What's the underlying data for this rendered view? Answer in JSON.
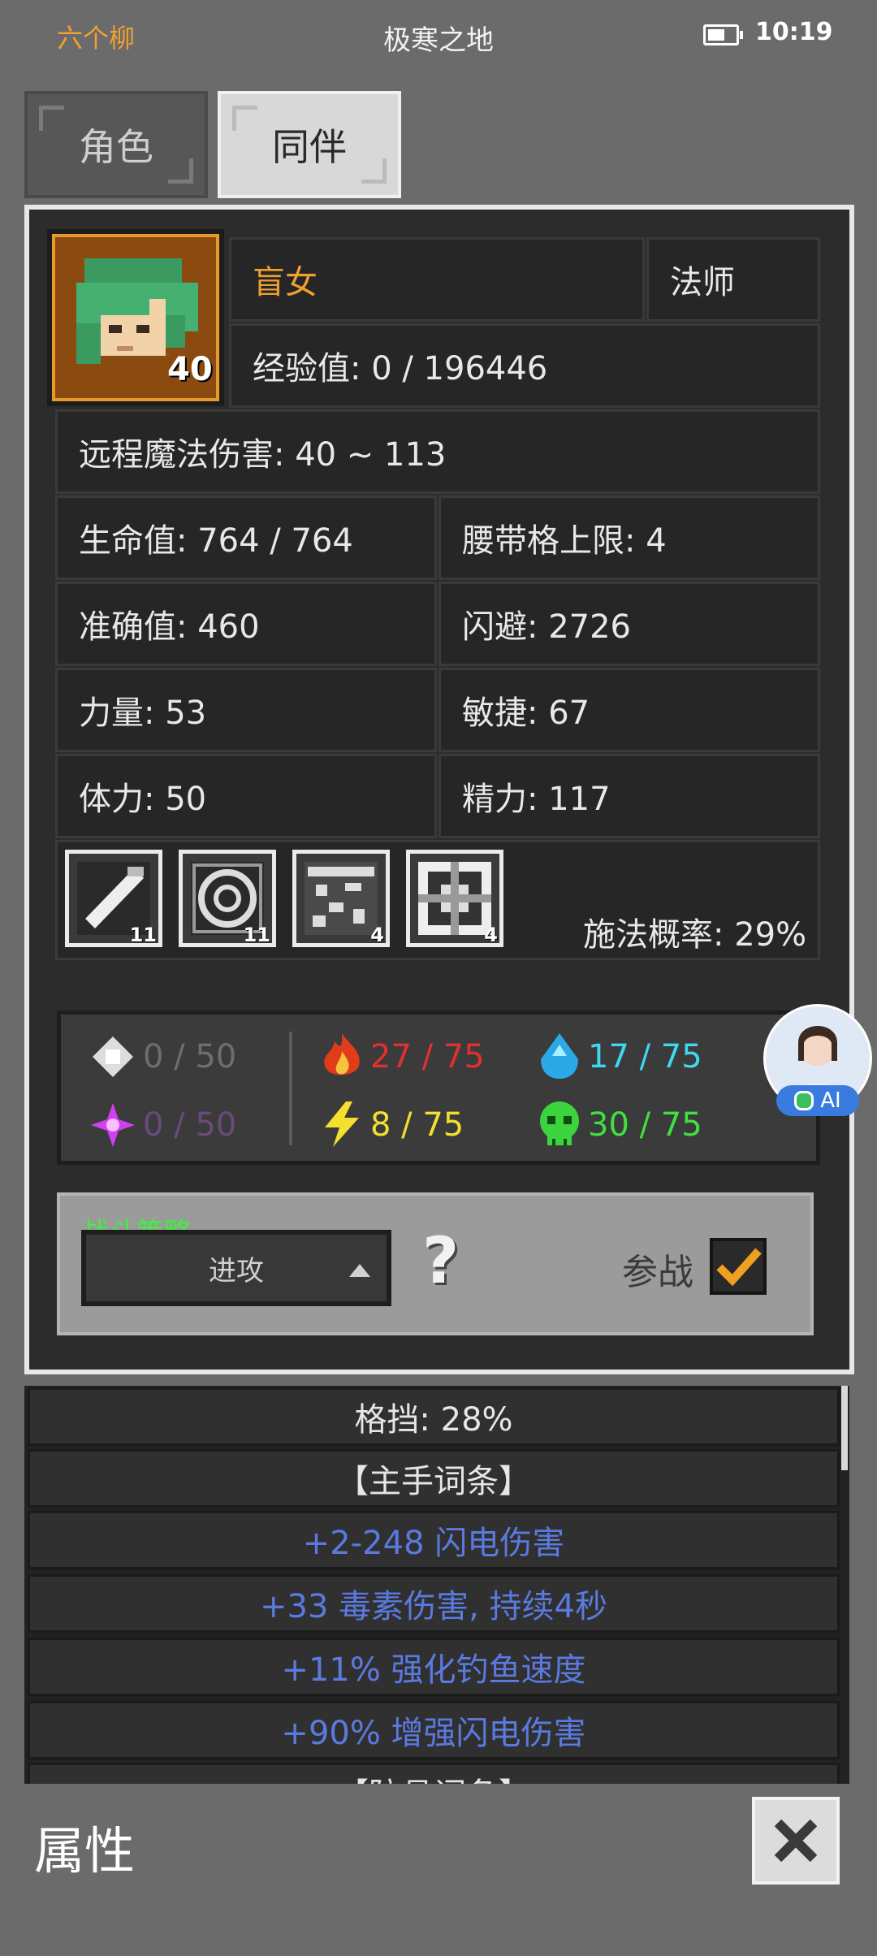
{
  "status_bar": {
    "player_name": "六个柳",
    "location": "极寒之地",
    "time": "10:19"
  },
  "tabs": [
    {
      "label": "角色"
    },
    {
      "label": "同伴"
    }
  ],
  "companion": {
    "name": "盲女",
    "class": "法师",
    "level": "40",
    "exp": "经验值: 0 / 196446",
    "damage": "远程魔法伤害: 40 ~ 113",
    "stats": [
      "生命值: 764 / 764",
      "腰带格上限: 4",
      "准确值: 460",
      "闪避: 2726",
      "力量: 53",
      "敏捷: 67",
      "体力: 50",
      "精力: 117"
    ],
    "skills": [
      {
        "icon": "wand-skill-icon",
        "count": "11"
      },
      {
        "icon": "rune-circle-skill-icon",
        "count": "11"
      },
      {
        "icon": "cracked-stone-skill-icon",
        "count": "4"
      },
      {
        "icon": "frost-block-skill-icon",
        "count": "4"
      }
    ],
    "cast_chance": "施法概率: 29%"
  },
  "resistances": [
    {
      "icon": "physical-icon",
      "value": "0 / 50",
      "color": "#6e6e6e"
    },
    {
      "icon": "arcane-icon",
      "value": "0 / 50",
      "color": "#6a4a7a"
    },
    {
      "icon": "fire-icon",
      "value": "27 / 75",
      "color": "#e03030"
    },
    {
      "icon": "lightning-icon",
      "value": "8 / 75",
      "color": "#f0e030"
    },
    {
      "icon": "cold-icon",
      "value": "17 / 75",
      "color": "#40d8f0"
    },
    {
      "icon": "poison-icon",
      "value": "30 / 75",
      "color": "#40e040"
    }
  ],
  "strategy": {
    "label": "战斗策略",
    "selected": "进攻",
    "help": "?",
    "join_label": "参战",
    "join_checked": true
  },
  "ai_badge": "AI",
  "attributes": [
    {
      "text": "格挡: 28%",
      "color": "#e8e8e8"
    },
    {
      "text": "【主手词条】",
      "color": "#e8e8e8"
    },
    {
      "text": "+2-248 闪电伤害",
      "color": "#5a7ae0"
    },
    {
      "text": "+33 毒素伤害, 持续4秒",
      "color": "#5a7ae0"
    },
    {
      "text": "+11% 强化钓鱼速度",
      "color": "#5a7ae0"
    },
    {
      "text": "+90% 增强闪电伤害",
      "color": "#5a7ae0"
    },
    {
      "text": "【防具词条】",
      "color": "#e8e8e8"
    }
  ],
  "footer": {
    "title": "属性"
  }
}
